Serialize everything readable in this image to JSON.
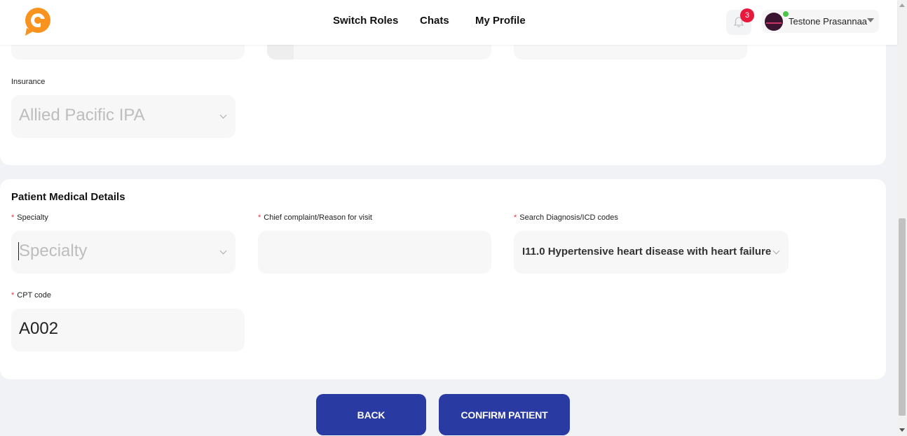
{
  "header": {
    "nav": [
      "Switch Roles",
      "Chats",
      "My Profile"
    ],
    "notification_count": "3",
    "user_name": "Testone Prasannaa"
  },
  "insurance": {
    "label": "Insurance",
    "value": "Allied Pacific IPA"
  },
  "medical": {
    "title": "Patient Medical Details",
    "specialty_label": "Specialty",
    "specialty_placeholder": "Specialty",
    "complaint_label": "Chief complaint/Reason for visit",
    "complaint_value": "",
    "diagnosis_label": "Search Diagnosis/ICD codes",
    "diagnosis_value": "I11.0 Hypertensive heart disease with heart failure",
    "cpt_label": "CPT code",
    "cpt_value": "A002",
    "required_mark": "*"
  },
  "buttons": {
    "back": "BACK",
    "confirm": "CONFIRM PATIENT"
  },
  "colors": {
    "accent": "#2a3aa3",
    "logo": "#f7931e",
    "required": "#e0353f",
    "badge": "#e8193c"
  }
}
